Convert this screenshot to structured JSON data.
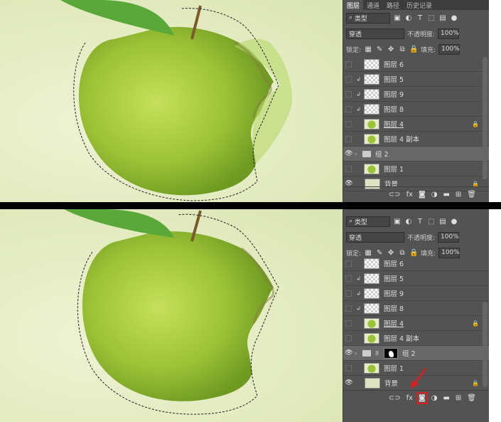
{
  "tabs": [
    "图层",
    "通道",
    "路径",
    "历史记录"
  ],
  "filter": {
    "kind": "类型"
  },
  "blend": {
    "mode": "穿透",
    "opacity_label": "不透明度:",
    "opacity": "100%"
  },
  "lock": {
    "label": "锁定:",
    "fill_label": "填充:",
    "fill": "100%"
  },
  "top_layers": [
    {
      "name": "图层 6",
      "eye": false,
      "clip": false,
      "thumb": "checker"
    },
    {
      "name": "图层 5",
      "eye": false,
      "clip": true,
      "thumb": "checker"
    },
    {
      "name": "图层 9",
      "eye": false,
      "clip": true,
      "thumb": "checker"
    },
    {
      "name": "图层 8",
      "eye": false,
      "clip": true,
      "thumb": "checker"
    },
    {
      "name": "图层 4",
      "eye": false,
      "clip": false,
      "thumb": "apple",
      "locked": true,
      "underline": true
    },
    {
      "name": "图层 4 副本",
      "eye": false,
      "clip": false,
      "thumb": "apple"
    },
    {
      "name": "组 2",
      "eye": true,
      "group": true,
      "selected": true
    },
    {
      "name": "图层 1",
      "eye": false,
      "clip": false,
      "thumb": "apple"
    },
    {
      "name": "背景",
      "eye": true,
      "clip": false,
      "thumb": "plain",
      "locked": true
    }
  ],
  "bottom_layers": [
    {
      "name": "图层 6",
      "eye": false,
      "clip": false,
      "thumb": "checker"
    },
    {
      "name": "图层 5",
      "eye": false,
      "clip": true,
      "thumb": "checker"
    },
    {
      "name": "图层 9",
      "eye": false,
      "clip": true,
      "thumb": "checker"
    },
    {
      "name": "图层 8",
      "eye": false,
      "clip": true,
      "thumb": "checker"
    },
    {
      "name": "图层 4",
      "eye": false,
      "clip": false,
      "thumb": "apple",
      "locked": true,
      "underline": true
    },
    {
      "name": "图层 4 副本",
      "eye": false,
      "clip": false,
      "thumb": "apple"
    },
    {
      "name": "组 2",
      "eye": true,
      "group": true,
      "selected": true,
      "mask": true
    },
    {
      "name": "图层 1",
      "eye": false,
      "clip": false,
      "thumb": "apple"
    },
    {
      "name": "背景",
      "eye": true,
      "clip": false,
      "thumb": "plain",
      "locked": true
    }
  ],
  "footer": [
    "link-icon",
    "fx",
    "mask-icon",
    "adjustment-icon",
    "folder-icon",
    "new-layer-icon",
    "trash-icon"
  ],
  "annotation": {
    "arrow_color": "#e01d1d",
    "highlight_target": "add-mask-button"
  }
}
